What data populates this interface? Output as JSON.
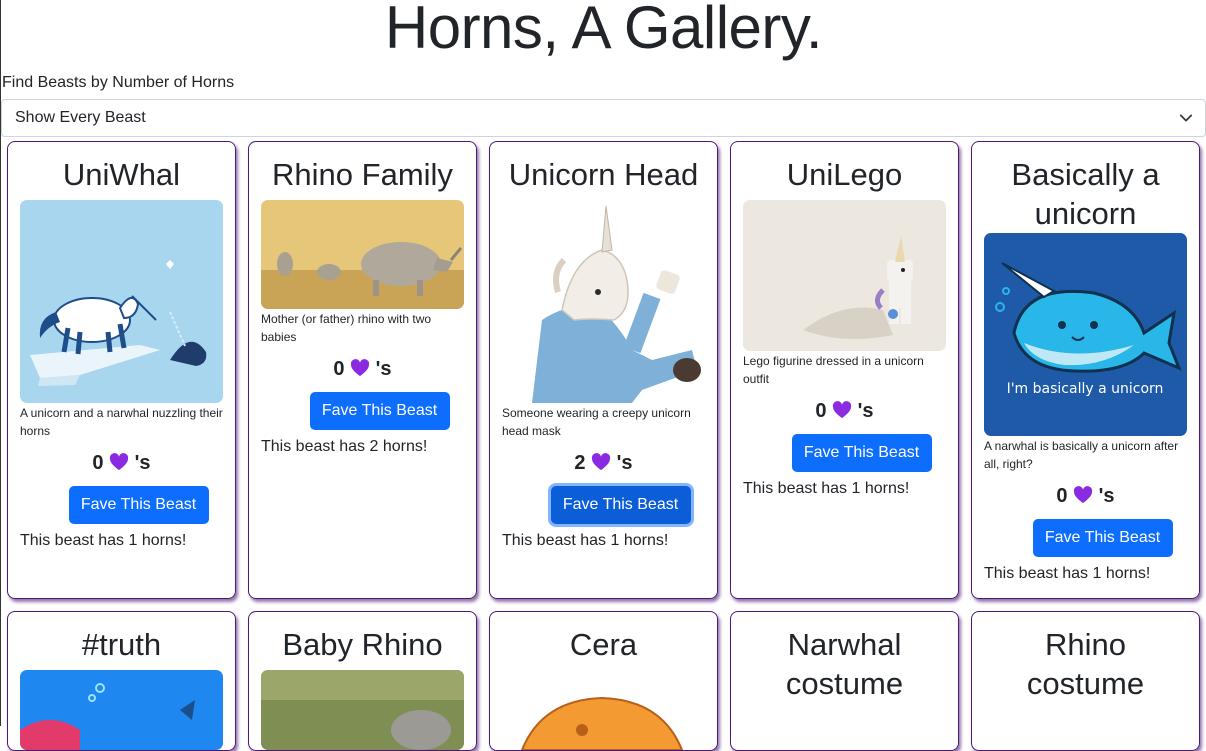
{
  "page": {
    "title": "Horns, A Gallery."
  },
  "filter": {
    "label": "Find Beasts by Number of Horns",
    "selected": "Show Every Beast"
  },
  "button_label": "Fave This Beast",
  "fav_suffix": "'s",
  "colors": {
    "accent": "#0d6efd",
    "card_border": "#4b1a78",
    "heart": "#8a2be2"
  },
  "beasts_row1": [
    {
      "title": "UniWhal",
      "description": "A unicorn and a narwhal nuzzling their horns",
      "favorites": "0",
      "horns_text": "This beast has 1 horns!"
    },
    {
      "title": "Rhino Family",
      "description": "Mother (or father) rhino with two babies",
      "favorites": "0",
      "horns_text": "This beast has 2 horns!"
    },
    {
      "title": "Unicorn Head",
      "description": "Someone wearing a creepy unicorn head mask",
      "favorites": "2",
      "horns_text": "This beast has 1 horns!"
    },
    {
      "title": "UniLego",
      "description": "Lego figurine dressed in a unicorn outfit",
      "favorites": "0",
      "horns_text": "This beast has 1 horns!"
    },
    {
      "title": "Basically a unicorn",
      "description": "A narwhal is basically a unicorn after all, right?",
      "favorites": "0",
      "horns_text": "This beast has 1 horns!",
      "image_text": "I'm basically a unicorn"
    }
  ],
  "beasts_row2": [
    {
      "title": "#truth"
    },
    {
      "title": "Baby Rhino"
    },
    {
      "title": "Cera"
    },
    {
      "title": "Narwhal costume"
    },
    {
      "title": "Rhino costume"
    }
  ]
}
